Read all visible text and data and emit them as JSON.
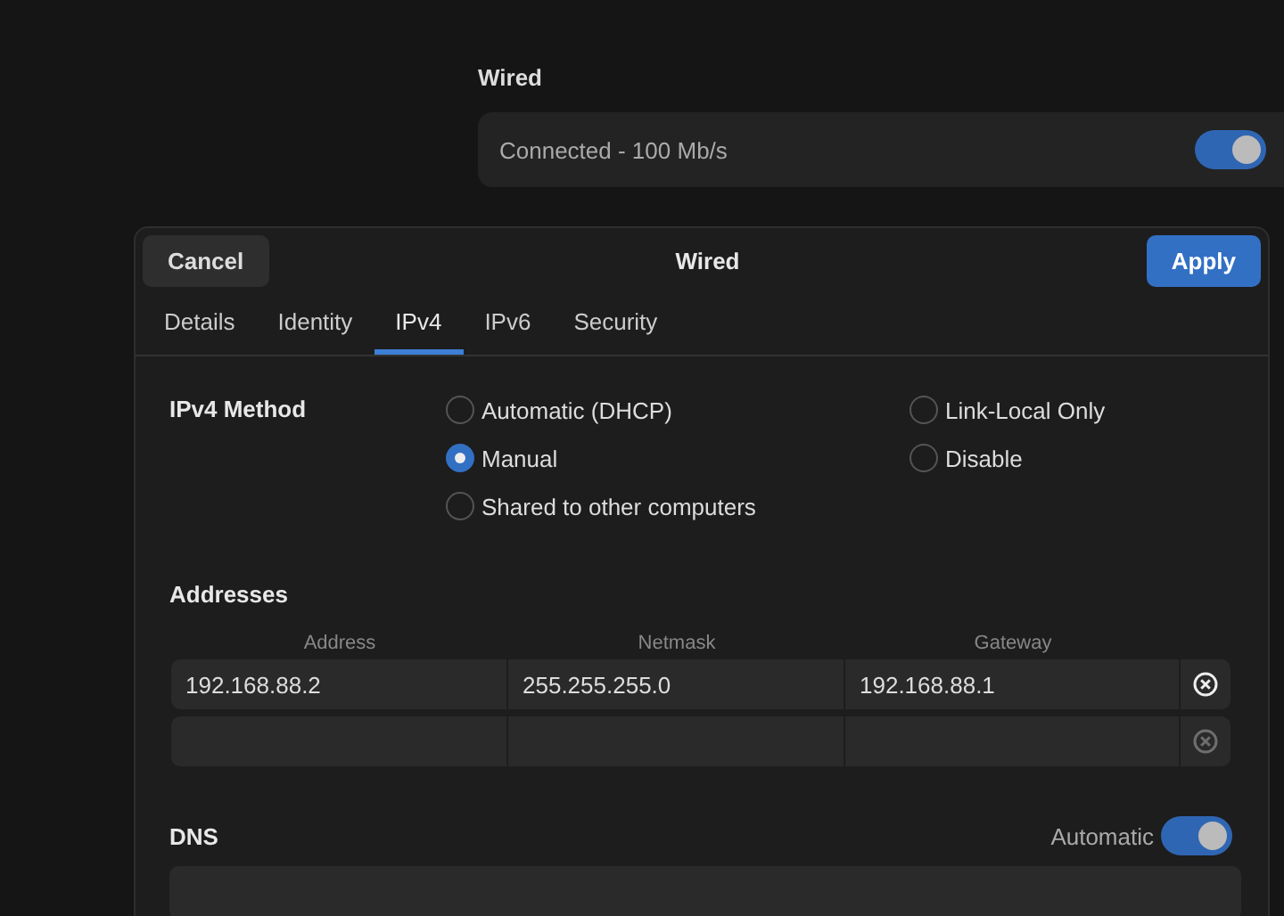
{
  "background": {
    "section_title": "Wired",
    "connection": {
      "status": "Connected - 100 Mb/s",
      "on": true
    }
  },
  "dialog": {
    "cancel": "Cancel",
    "title": "Wired",
    "apply": "Apply",
    "tabs": [
      {
        "label": "Details",
        "selected": false
      },
      {
        "label": "Identity",
        "selected": false
      },
      {
        "label": "IPv4",
        "selected": true
      },
      {
        "label": "IPv6",
        "selected": false
      },
      {
        "label": "Security",
        "selected": false
      }
    ],
    "ipv4_method": {
      "label": "IPv4 Method",
      "options": [
        {
          "label": "Automatic (DHCP)",
          "selected": false
        },
        {
          "label": "Link-Local Only",
          "selected": false
        },
        {
          "label": "Manual",
          "selected": true
        },
        {
          "label": "Disable",
          "selected": false
        },
        {
          "label": "Shared to other computers",
          "selected": false
        }
      ]
    },
    "addresses": {
      "label": "Addresses",
      "columns": [
        "Address",
        "Netmask",
        "Gateway"
      ],
      "rows": [
        {
          "address": "192.168.88.2",
          "netmask": "255.255.255.0",
          "gateway": "192.168.88.1",
          "disabled": false
        },
        {
          "disabled": true
        }
      ]
    },
    "dns": {
      "label": "DNS",
      "automatic_label": "Automatic",
      "automatic": true
    }
  }
}
